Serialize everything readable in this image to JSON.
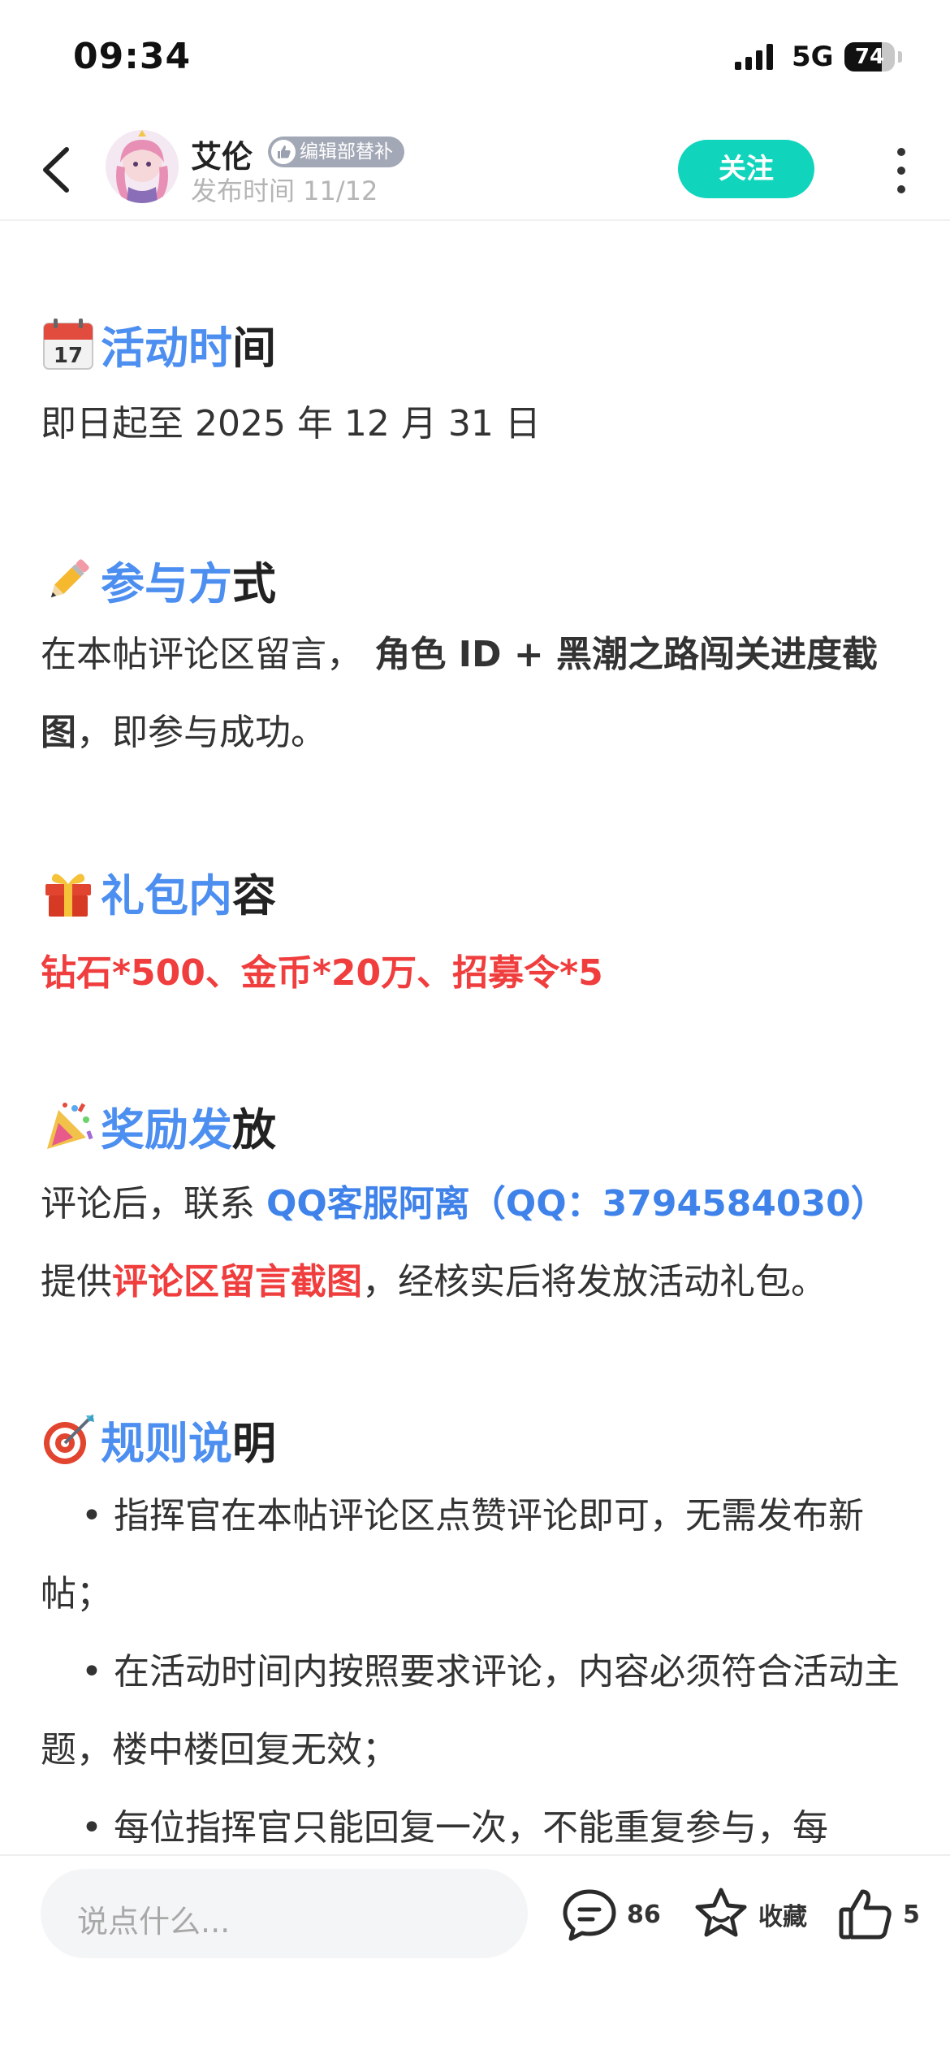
{
  "status_bar": {
    "time": "09:34",
    "network": "5G",
    "battery": "74",
    "battery_level": 0.74
  },
  "header": {
    "username": "艾伦",
    "badge": "编辑部替补",
    "post_time": "发布时间 11/12",
    "follow_label": "关注"
  },
  "sections": {
    "s1": {
      "title_blue": "活动时",
      "title_dark": "间",
      "body": "即日起至 2025 年 12 月 31 日",
      "icon": "calendar-icon"
    },
    "s2": {
      "title_blue": "参与方",
      "title_dark": "式",
      "body_prefix": "在本帖评论区留言，",
      "body_bold": " 角色 ID + 黑潮之路闯关进度截图",
      "body_suffix": "，即参与成功。",
      "icon": "pencil-icon"
    },
    "s3": {
      "title_blue": "礼包内",
      "title_dark": "容",
      "body": "钻石*500、金币*20万、招募令*5",
      "icon": "gift-icon"
    },
    "s4": {
      "title_blue": "奖励发",
      "title_dark": "放",
      "body_prefix": "评论后，联系 ",
      "body_link": "QQ客服阿离（QQ：3794584030）",
      "body_mid": "提供",
      "body_red": "评论区留言截图",
      "body_suffix": "，经核实后将发放活动礼包。",
      "icon": "confetti-icon"
    },
    "s5": {
      "title_blue": "规则说",
      "title_dark": "明",
      "icon": "target-icon",
      "rules": [
        "• 指挥官在本帖评论区点赞评论即可，无需发布新帖；",
        "• 在活动时间内按照要求评论，内容必须符合活动主题，楼中楼回复无效；",
        "• 每位指挥官只能回复一次，不能重复参与，每"
      ]
    }
  },
  "bottom_bar": {
    "input_placeholder": "说点什么...",
    "comments_count": "86",
    "favorite_label": "收藏",
    "likes_count": "5"
  },
  "colors": {
    "accent_teal": "#11d4bd",
    "title_blue": "#4d8ff0",
    "highlight_red": "#f03d3d",
    "link_blue": "#3f82ea"
  }
}
